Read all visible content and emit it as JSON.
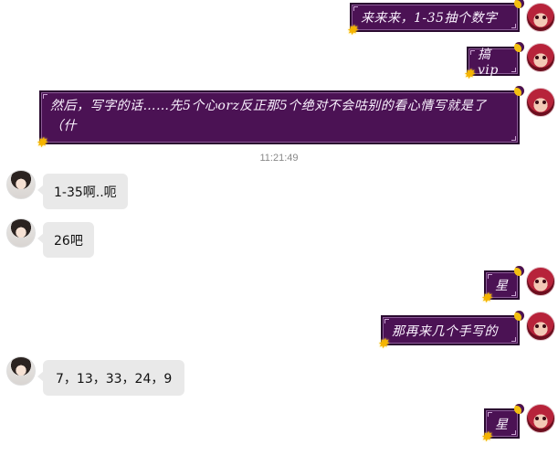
{
  "timestamp": "11:21:49",
  "messages": [
    {
      "sender": "self",
      "text": "来来来，1-35抽个数字"
    },
    {
      "sender": "self",
      "text": "搞vip"
    },
    {
      "sender": "self",
      "text": "然后，写字的话……先5个心orz反正那5个绝对不会咕别的看心情写就是了（什"
    },
    {
      "sender": "other",
      "text": "1-35啊..呃"
    },
    {
      "sender": "other",
      "text": "26吧"
    },
    {
      "sender": "self",
      "text": "星"
    },
    {
      "sender": "self",
      "text": "那再来几个手写的"
    },
    {
      "sender": "other",
      "text": "7，13，33，24，9"
    },
    {
      "sender": "self",
      "text": "星"
    }
  ],
  "colors": {
    "self_bubble": "#4b1254",
    "other_bubble": "#e9e9e9",
    "timestamp_text": "#888888"
  }
}
